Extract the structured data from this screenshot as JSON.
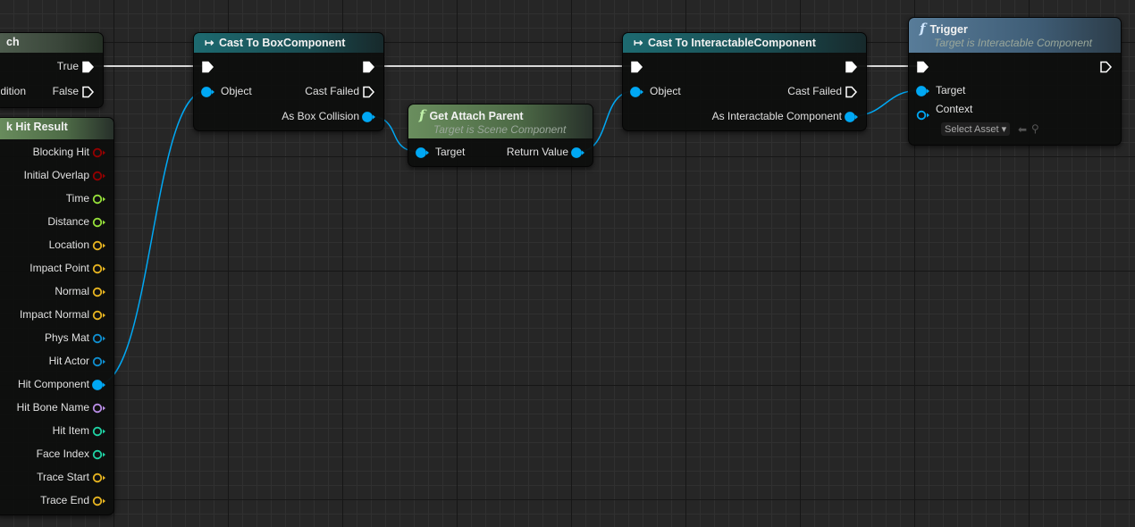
{
  "colors": {
    "exec": "#ffffff",
    "object": "#00a8f4",
    "bool": "#940000",
    "float": "#96e03a",
    "vector": "#e8b520",
    "name": "#b98de6",
    "int": "#1fd3a4",
    "physmat": "#0f8fd0"
  },
  "nodes": [
    {
      "id": "branch",
      "title": "ch",
      "rows": [
        {
          "right": {
            "label": "True",
            "type": "exec",
            "connected": true
          }
        },
        {
          "left_label": "dition",
          "right": {
            "label": "False",
            "type": "exec",
            "connected": false
          }
        }
      ]
    },
    {
      "id": "break",
      "title": "k Hit Result",
      "rows": [
        {
          "right": {
            "label": "Blocking Hit",
            "type": "bool"
          }
        },
        {
          "right": {
            "label": "Initial Overlap",
            "type": "bool"
          }
        },
        {
          "right": {
            "label": "Time",
            "type": "float"
          }
        },
        {
          "right": {
            "label": "Distance",
            "type": "float"
          }
        },
        {
          "right": {
            "label": "Location",
            "type": "vector"
          }
        },
        {
          "right": {
            "label": "Impact Point",
            "type": "vector"
          }
        },
        {
          "right": {
            "label": "Normal",
            "type": "vector"
          }
        },
        {
          "right": {
            "label": "Impact Normal",
            "type": "vector"
          }
        },
        {
          "right": {
            "label": "Phys Mat",
            "type": "physmat"
          }
        },
        {
          "right": {
            "label": "Hit Actor",
            "type": "physmat"
          }
        },
        {
          "right": {
            "label": "Hit Component",
            "type": "object",
            "connected": true
          }
        },
        {
          "right": {
            "label": "Hit Bone Name",
            "type": "name"
          }
        },
        {
          "right": {
            "label": "Hit Item",
            "type": "int"
          }
        },
        {
          "right": {
            "label": "Face Index",
            "type": "int"
          }
        },
        {
          "right": {
            "label": "Trace Start",
            "type": "vector"
          }
        },
        {
          "right": {
            "label": "Trace End",
            "type": "vector"
          }
        }
      ]
    },
    {
      "id": "castbox",
      "title": "Cast To BoxComponent",
      "icon": "cast-arrow-icon",
      "rows": [
        {
          "left": {
            "label": "",
            "type": "exec",
            "connected": true
          },
          "right": {
            "label": "",
            "type": "exec",
            "connected": true
          }
        },
        {
          "left": {
            "label": "Object",
            "type": "object",
            "connected": true
          },
          "right": {
            "label": "Cast Failed",
            "type": "exec",
            "connected": false
          }
        },
        {
          "right": {
            "label": "As Box Collision",
            "type": "object",
            "connected": true
          }
        }
      ]
    },
    {
      "id": "getparent",
      "title": "Get Attach Parent",
      "subtitle": "Target is Scene Component",
      "icon": "function-icon",
      "rows": [
        {
          "left": {
            "label": "Target",
            "type": "object",
            "connected": true
          },
          "right": {
            "label": "Return Value",
            "type": "object",
            "connected": true
          }
        }
      ]
    },
    {
      "id": "castint",
      "title": "Cast To InteractableComponent",
      "icon": "cast-arrow-icon",
      "rows": [
        {
          "left": {
            "label": "",
            "type": "exec",
            "connected": true
          },
          "right": {
            "label": "",
            "type": "exec",
            "connected": true
          }
        },
        {
          "left": {
            "label": "Object",
            "type": "object",
            "connected": true
          },
          "right": {
            "label": "Cast Failed",
            "type": "exec",
            "connected": false
          }
        },
        {
          "right": {
            "label": "As Interactable Component",
            "type": "object",
            "connected": true
          }
        }
      ]
    },
    {
      "id": "trigger",
      "title": "Trigger",
      "subtitle": "Target is Interactable Component",
      "icon": "function-icon",
      "rows": [
        {
          "left": {
            "label": "",
            "type": "exec",
            "connected": true
          },
          "right": {
            "label": "",
            "type": "exec",
            "connected": false
          }
        },
        {
          "left": {
            "label": "Target",
            "type": "object",
            "connected": true
          }
        },
        {
          "left": {
            "label": "Context",
            "type": "object",
            "connected": false
          },
          "select": "Select Asset"
        }
      ]
    }
  ]
}
